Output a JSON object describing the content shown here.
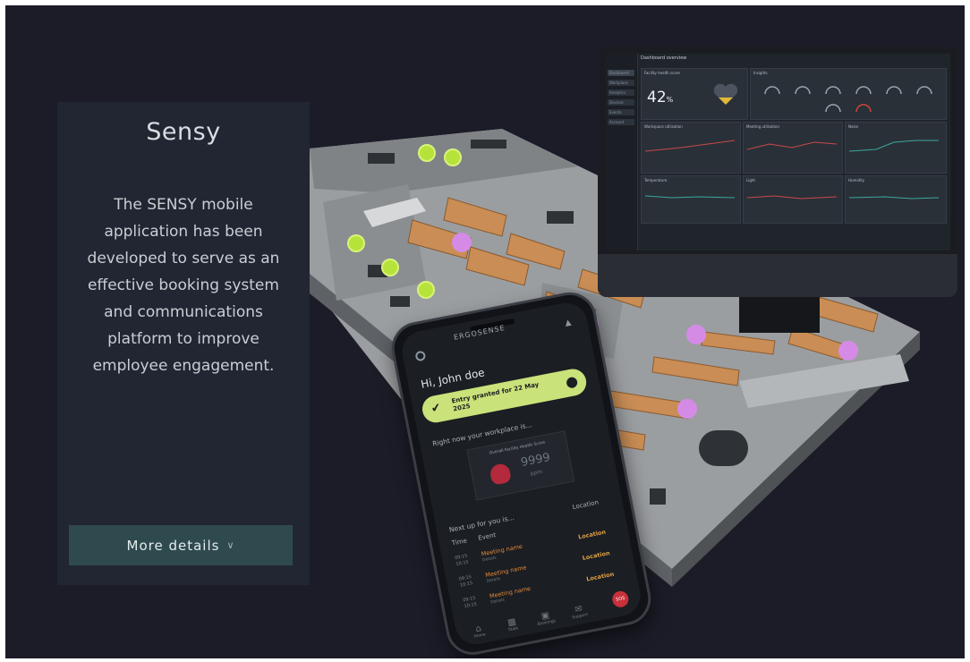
{
  "card": {
    "title": "Sensy",
    "body": "The SENSY mobile application has been developed to serve as an effective booking system and communications platform to improve employee engagement.",
    "button_label": "More details"
  },
  "dashboard": {
    "title": "Dashboard overview",
    "health_label": "Facility health score",
    "health_value": "42",
    "health_unit": "%",
    "sensors_label": "Insights",
    "sidebar": [
      "Dashboard",
      "Workplace",
      "Analytics",
      "Devices",
      "Events",
      "Account"
    ],
    "panels": [
      "Workspace utilisation",
      "Meeting utilisation",
      "Noise",
      "Temperature",
      "Light",
      "Humidity"
    ]
  },
  "phone": {
    "logo": "ERGOSENSE",
    "greeting": "Hi, John doe",
    "entry": "Entry granted for 22 May 2025",
    "right_now": "Right now your workplace is...",
    "score_label": "Overall Facility Health Score",
    "score_value": "9999",
    "score_unit": "ppm",
    "next_up": "Next up for you is...",
    "location_header": "Location",
    "time_header": "Time",
    "event_header": "Event",
    "rows": [
      {
        "time": "09:15 10:15",
        "event": "Meeting name",
        "sub": "Details",
        "location": "Location"
      },
      {
        "time": "09:15 10:15",
        "event": "Meeting name",
        "sub": "Details",
        "location": "Location"
      },
      {
        "time": "09:15 10:15",
        "event": "Meeting name",
        "sub": "Details",
        "location": "Location"
      }
    ],
    "nav": [
      "Home",
      "Stats",
      "Bookings",
      "Support"
    ],
    "sos": "SOS"
  },
  "colors": {
    "background": "#1b1c27",
    "card": "#222632",
    "button": "#2f4a4f",
    "accent_green": "#c9e27a",
    "accent_pink": "#d58be6",
    "sensor_green": "#b6e23a",
    "desk_wood": "#c98d55"
  }
}
